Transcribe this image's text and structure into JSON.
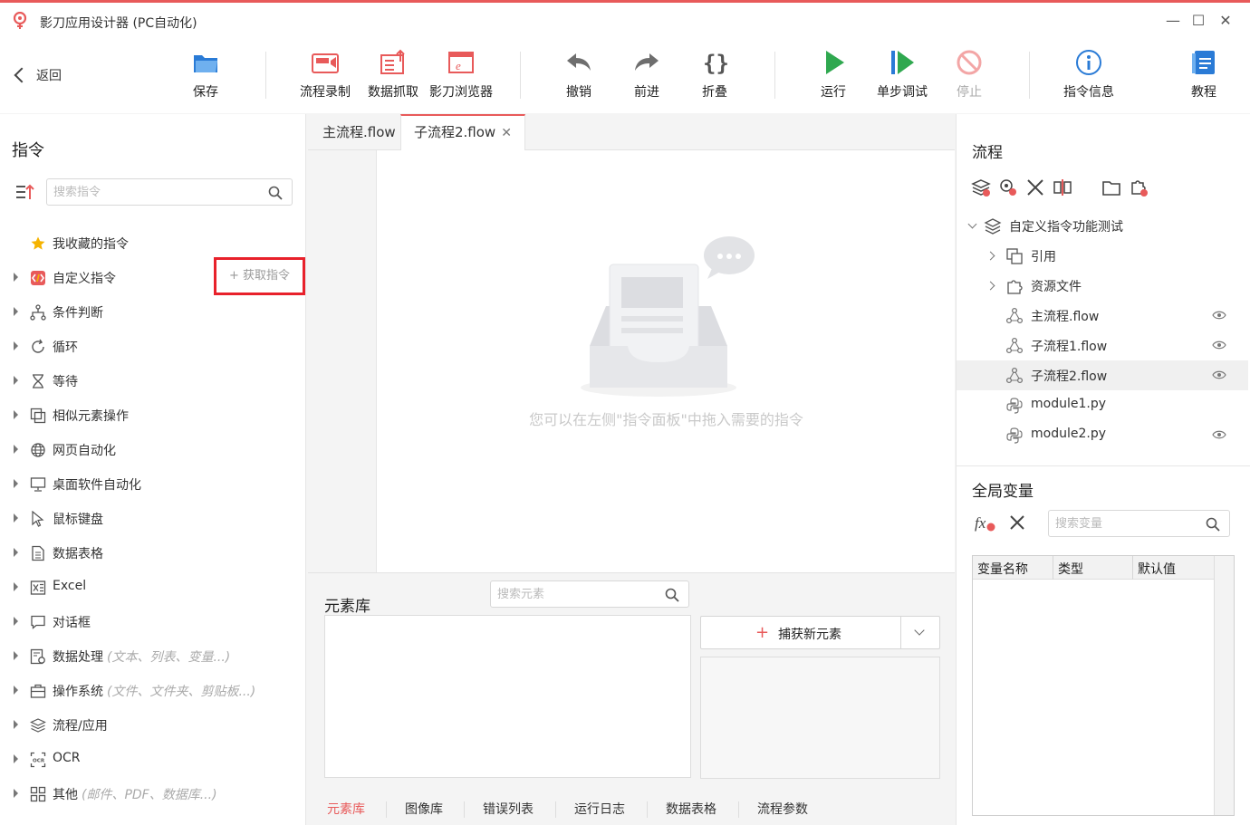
{
  "window": {
    "title": "影刀应用设计器 (PC自动化)"
  },
  "toolbar": {
    "back_label": "返回",
    "save": "保存",
    "record": "流程录制",
    "capture_data": "数据抓取",
    "browser": "影刀浏览器",
    "undo": "撤销",
    "redo": "前进",
    "fold": "折叠",
    "run": "运行",
    "step_debug": "单步调试",
    "stop": "停止",
    "cmd_info": "指令信息",
    "tutorial": "教程"
  },
  "commands_panel": {
    "title": "指令",
    "search_placeholder": "搜索指令",
    "get_cmd_button": "+ 获取指令",
    "items": [
      {
        "label": "我收藏的指令",
        "icon": "star-icon",
        "hint": ""
      },
      {
        "label": "自定义指令",
        "icon": "custom-cmd-icon",
        "hint": ""
      },
      {
        "label": "条件判断",
        "icon": "branch-icon",
        "hint": ""
      },
      {
        "label": "循环",
        "icon": "loop-icon",
        "hint": ""
      },
      {
        "label": "等待",
        "icon": "hourglass-icon",
        "hint": ""
      },
      {
        "label": "相似元素操作",
        "icon": "similar-element-icon",
        "hint": ""
      },
      {
        "label": "网页自动化",
        "icon": "globe-icon",
        "hint": ""
      },
      {
        "label": "桌面软件自动化",
        "icon": "monitor-icon",
        "hint": ""
      },
      {
        "label": "鼠标键盘",
        "icon": "cursor-icon",
        "hint": ""
      },
      {
        "label": "数据表格",
        "icon": "sheet-icon",
        "hint": ""
      },
      {
        "label": "Excel",
        "icon": "excel-icon",
        "hint": ""
      },
      {
        "label": "对话框",
        "icon": "dialog-icon",
        "hint": ""
      },
      {
        "label": "数据处理",
        "icon": "data-process-icon",
        "hint": "(文本、列表、变量...)"
      },
      {
        "label": "操作系统",
        "icon": "toolbox-icon",
        "hint": "(文件、文件夹、剪贴板...)"
      },
      {
        "label": "流程/应用",
        "icon": "layers-icon",
        "hint": ""
      },
      {
        "label": "OCR",
        "icon": "ocr-icon",
        "hint": ""
      },
      {
        "label": "其他",
        "icon": "grid-icon",
        "hint": "(邮件、PDF、数据库...)"
      }
    ]
  },
  "editor": {
    "tabs": [
      {
        "label": "主流程.flow"
      },
      {
        "label": "子流程2.flow"
      }
    ],
    "close_glyph": "✕",
    "empty_hint": "您可以在左侧\"指令面板\"中拖入需要的指令"
  },
  "element_library": {
    "title": "元素库",
    "search_placeholder": "搜索元素",
    "capture_button": "捕获新元素",
    "bottom_tabs": [
      "元素库",
      "图像库",
      "错误列表",
      "运行日志",
      "数据表格",
      "流程参数"
    ]
  },
  "flow_panel": {
    "title": "流程",
    "project": "自定义指令功能测试",
    "items": [
      {
        "label": "引用",
        "type": "folder"
      },
      {
        "label": "资源文件",
        "type": "folder"
      },
      {
        "label": "主流程.flow",
        "type": "flow"
      },
      {
        "label": "子流程1.flow",
        "type": "flow"
      },
      {
        "label": "子流程2.flow",
        "type": "flow"
      },
      {
        "label": "module1.py",
        "type": "py"
      },
      {
        "label": "module2.py",
        "type": "py"
      }
    ]
  },
  "global_vars": {
    "title": "全局变量",
    "search_placeholder": "搜索变量",
    "columns": [
      "变量名称",
      "类型",
      "默认值"
    ]
  },
  "colors": {
    "accent": "#e85a5a",
    "highlight_border": "#e8212b",
    "run_green": "#2fa84f",
    "info_blue": "#2a7bd6"
  }
}
